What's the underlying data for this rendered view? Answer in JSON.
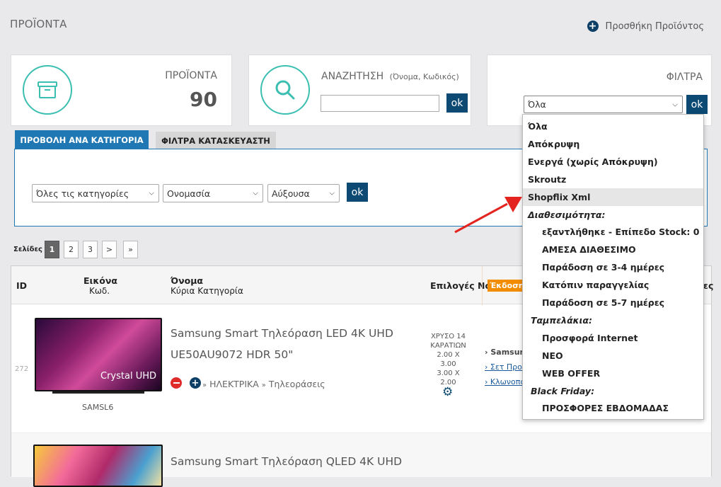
{
  "header": {
    "title": "ΠΡΟΪΟΝΤΑ",
    "add_product": "Προσθήκη Προϊόντος"
  },
  "stats": {
    "products_label": "ΠΡΟΪΟΝΤΑ",
    "products_count": "90"
  },
  "search": {
    "label": "ΑΝΑΖΗΤΗΣΗ",
    "hint": "(Όνομα, Κωδικός)",
    "value": "",
    "ok": "ok"
  },
  "filters": {
    "label": "ΦΙΛΤΡΑ",
    "selected": "Όλα",
    "ok": "ok",
    "options": [
      {
        "label": "Όλα",
        "group": false,
        "indent": false
      },
      {
        "label": "Απόκρυψη",
        "group": false,
        "indent": false
      },
      {
        "label": "Ενεργά (χωρίς Απόκρυψη)",
        "group": false,
        "indent": false
      },
      {
        "label": "Skroutz",
        "group": false,
        "indent": false
      },
      {
        "label": "Shopflix Xml",
        "group": false,
        "indent": false,
        "highlighted": true
      },
      {
        "label": "Διαθεσιμότητα:",
        "group": true,
        "indent": false
      },
      {
        "label": "εξαντλήθηκε - Επίπεδο Stock: 0",
        "group": false,
        "indent": true
      },
      {
        "label": "ΑΜΕΣΑ ΔΙΑΘΕΣΙΜΟ",
        "group": false,
        "indent": true
      },
      {
        "label": "Παράδοση σε 3-4 ημέρες",
        "group": false,
        "indent": true
      },
      {
        "label": "Κατόπιν παραγγελίας",
        "group": false,
        "indent": true
      },
      {
        "label": "Παράδοση σε 5-7 ημέρες",
        "group": false,
        "indent": true
      },
      {
        "label": "Ταμπελάκια:",
        "group": true,
        "indent": false
      },
      {
        "label": "Προσφορά Internet",
        "group": false,
        "indent": true
      },
      {
        "label": "ΝΕΟ",
        "group": false,
        "indent": true
      },
      {
        "label": "WEB OFFER",
        "group": false,
        "indent": true
      },
      {
        "label": "Black Friday:",
        "group": true,
        "indent": false
      },
      {
        "label": "ΠΡΟΣΦΟΡΕΣ ΕΒΔΟΜΑΔΑΣ",
        "group": false,
        "indent": true
      }
    ]
  },
  "tabs": {
    "by_category": "ΠΡΟΒΟΛΗ ΑΝΑ ΚΑΤΗΓΟΡΙΑ",
    "manufacturer_filters": "ΦΙΛΤΡΑ ΚΑΤΑΣΚΕΥΑΣΤΗ"
  },
  "category_filter": {
    "category": "Όλες τις κατηγορίες",
    "sort_by": "Ονομασία",
    "order": "Αύξουσα",
    "ok": "ok"
  },
  "pager": {
    "label": "Σελίδες",
    "pages": [
      "1",
      "2",
      "3"
    ],
    "next": ">",
    "last": "»"
  },
  "table": {
    "col_id": "ID",
    "col_image": "Εικόνα",
    "col_code": "Κωδ.",
    "col_name": "Όνομα",
    "col_main_category": "Κύρια Κατηγορία",
    "col_options": "Επιλογές Νο",
    "col_version": "Έκδοση",
    "col_cut": "ες"
  },
  "rows": [
    {
      "id": "272",
      "code": "SAMSL6",
      "image_text": "Crystal UHD",
      "name_line1": "Samsung Smart Τηλεόραση LED 4K UHD",
      "name_line2": "UE50AU9072 HDR 50\"",
      "category_main": "ΗΛΕΚΤΡΙΚΑ",
      "category_sub": "Τηλεοράσεις",
      "sep1": "»",
      "sep2": "»",
      "options_lines": [
        "ΧΡΥΣΟ 14",
        "ΚΑΡΑΤΙΩΝ",
        "2.00 X",
        "3.00",
        "3.00 X",
        "2.00"
      ],
      "links": [
        "› Samsung",
        "› Σετ Προϊό",
        "› Κλωνοπο"
      ]
    },
    {
      "name_line1": "Samsung Smart Τηλεόραση QLED 4K UHD"
    }
  ],
  "colors": {
    "accent_teal": "#3bbfb0",
    "primary_navy": "#0c4a73",
    "tab_blue": "#1f78b4",
    "orange": "#f28c00"
  }
}
